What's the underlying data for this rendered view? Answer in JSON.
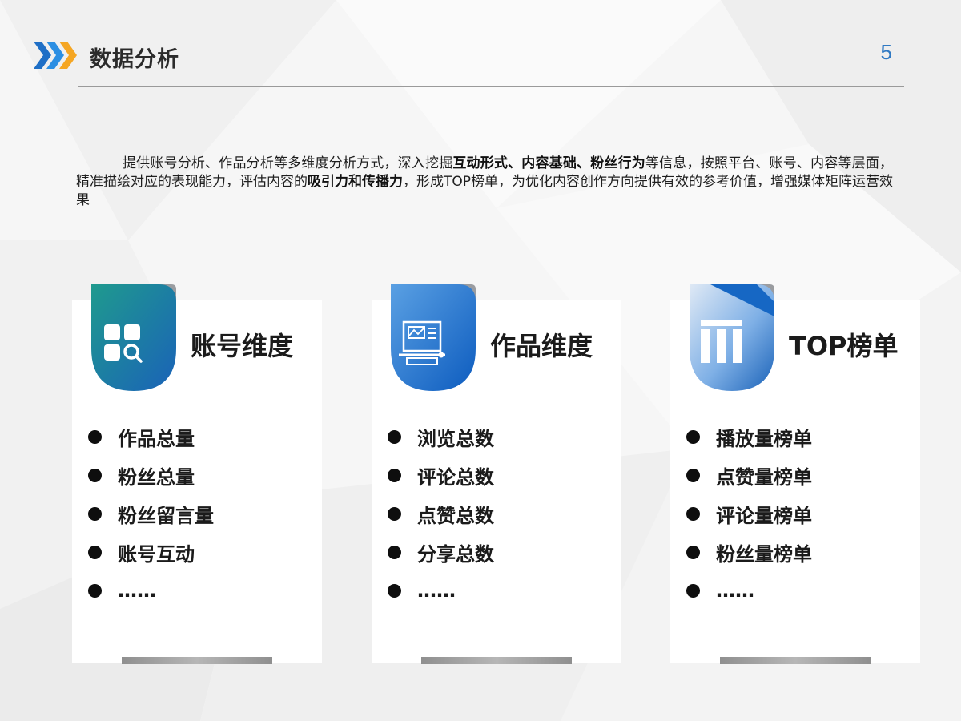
{
  "header": {
    "title": "数据分析",
    "page_number": "5",
    "arrow_colors": [
      "#1f6fc6",
      "#2c8fe3",
      "#f5a623"
    ]
  },
  "intro": {
    "p1": "提供账号分析、作品分析等多维度分析方式，深入挖掘",
    "b1": "互动形式、内容基础、粉丝行为",
    "p2": "等信息，按照平台、账号、内容等层面，精准描绘对应的表现能力，评估内容的",
    "b2": "吸引力和传播力",
    "p3": "，形成TOP榜单，为优化内容创作方向提供有效的参考价值，增强媒体矩阵运营效果"
  },
  "cards": [
    {
      "heading": "账号维度",
      "icon": "account-grid-search-icon",
      "gradient": [
        "#1f9a8e",
        "#1a62b8"
      ],
      "items": [
        "作品总量",
        "粉丝总量",
        "粉丝留言量",
        "账号互动",
        "……"
      ]
    },
    {
      "heading": "作品维度",
      "icon": "artwork-scroll-icon",
      "gradient": [
        "#5aa0e3",
        "#0d5cbf"
      ],
      "items": [
        "浏览总数",
        "评论总数",
        "点赞总数",
        "分享总数",
        "……"
      ]
    },
    {
      "heading": "TOP榜单",
      "icon": "ranking-bars-icon",
      "gradient": [
        "#cfe0f3",
        "#1a62b8"
      ],
      "items": [
        "播放量榜单",
        "点赞量榜单",
        "评论量榜单",
        "粉丝量榜单",
        "……"
      ]
    }
  ]
}
